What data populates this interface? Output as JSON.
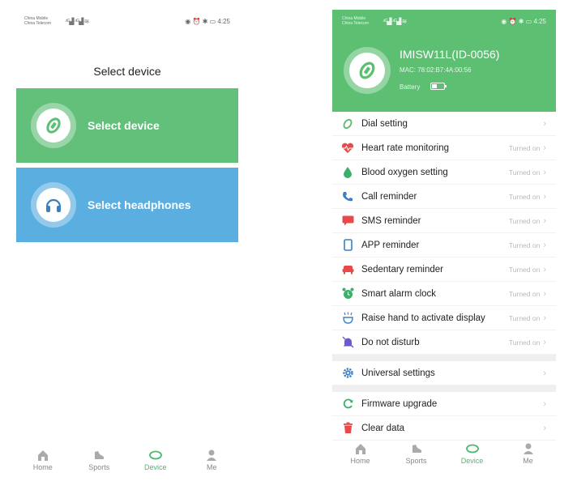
{
  "left": {
    "status": {
      "carrier1": "China Mobile",
      "carrier2": "China Telecom",
      "signal": "⁴ᴳ▟ ⁴ᴳ▟ ≋",
      "right": "◉ ⏰ ✱ ▭ 4:25"
    },
    "title": "Select device",
    "cards": [
      {
        "label": "Select device"
      },
      {
        "label": "Select headphones"
      }
    ],
    "tabs": [
      {
        "label": "Home"
      },
      {
        "label": "Sports"
      },
      {
        "label": "Device"
      },
      {
        "label": "Me"
      }
    ]
  },
  "right": {
    "status": {
      "carrier1": "China Mobile",
      "carrier2": "China Telecom",
      "signal": "⁴ᴳ▟ ⁴ᴳ▟ ≋",
      "right": "◉ ⏰ ✱ ▭ 4:25"
    },
    "device": {
      "name": "IMISW11L(ID-0056)",
      "mac": "MAC: 78:02:B7:4A:00:56",
      "battery_label": "Battery"
    },
    "menu": [
      {
        "label": "Dial setting",
        "value": "",
        "icon": "watch-icon"
      },
      {
        "label": "Heart rate monitoring",
        "value": "Turned on",
        "icon": "heart-icon"
      },
      {
        "label": "Blood oxygen setting",
        "value": "Turned on",
        "icon": "drop-icon"
      },
      {
        "label": "Call reminder",
        "value": "Turned on",
        "icon": "phone-icon"
      },
      {
        "label": "SMS reminder",
        "value": "Turned on",
        "icon": "sms-icon"
      },
      {
        "label": "APP reminder",
        "value": "Turned on",
        "icon": "app-icon"
      },
      {
        "label": "Sedentary reminder",
        "value": "Turned on",
        "icon": "sofa-icon"
      },
      {
        "label": "Smart alarm clock",
        "value": "Turned on",
        "icon": "alarm-icon"
      },
      {
        "label": "Raise hand to activate display",
        "value": "Turned on",
        "icon": "hand-icon"
      },
      {
        "label": "Do not disturb",
        "value": "Turned on",
        "icon": "bell-off-icon"
      }
    ],
    "universal": {
      "label": "Universal settings"
    },
    "firmware": {
      "label": "Firmware upgrade"
    },
    "clear": {
      "label": "Clear data"
    },
    "tabs": [
      {
        "label": "Home"
      },
      {
        "label": "Sports"
      },
      {
        "label": "Device"
      },
      {
        "label": "Me"
      }
    ]
  },
  "colors": {
    "green": "#5cbf72",
    "blue": "#5aaee0",
    "active_tab": "#4db871"
  }
}
